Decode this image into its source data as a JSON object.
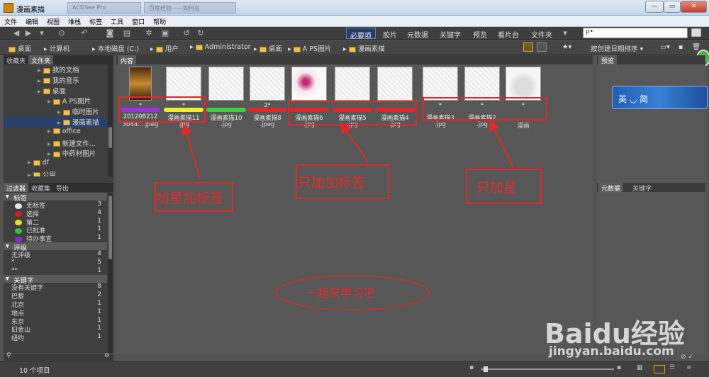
{
  "window": {
    "title": "漫画素描",
    "tab_ghost_1": "ACDSee Pro",
    "tab_ghost_2": "百度经验——如何在"
  },
  "menu": [
    "文件",
    "编辑",
    "视图",
    "堆栈",
    "标签",
    "工具",
    "窗口",
    "帮助"
  ],
  "workspaces": [
    "必要项",
    "胶片",
    "元数据",
    "关键字",
    "预览",
    "看片台",
    "文件夹"
  ],
  "search": {
    "placeholder": "ρ•"
  },
  "breadcrumb": [
    "桌面",
    "计算机",
    "本地磁盘 (C:)",
    "用户",
    "Administrator",
    "桌面",
    "A PS图片",
    "漫画素描"
  ],
  "sort_label": "按创建日期排序",
  "left_tabs": [
    "收藏夹",
    "文件夹"
  ],
  "tree": [
    {
      "label": "我的文档",
      "indent": 62
    },
    {
      "label": "我的音乐",
      "indent": 62
    },
    {
      "label": "桌面",
      "indent": 62
    },
    {
      "label": "A PS图片",
      "indent": 76
    },
    {
      "label": "临时图片",
      "indent": 90
    },
    {
      "label": "漫画素描",
      "indent": 90,
      "selected": true
    },
    {
      "label": "office",
      "indent": 76
    },
    {
      "label": "新建文件...",
      "indent": 76
    },
    {
      "label": "中药材图片",
      "indent": 76
    },
    {
      "label": "df",
      "indent": 48
    },
    {
      "label": "公用",
      "indent": 48
    }
  ],
  "filter_tabs": [
    "过滤器",
    "收藏集",
    "导出"
  ],
  "filters": {
    "labels_heading": "标签",
    "labels": [
      {
        "name": "无标签",
        "count": "3",
        "color": "#e8e8e8"
      },
      {
        "name": "选择",
        "count": "4",
        "color": "#d42020"
      },
      {
        "name": "第二",
        "count": "1",
        "color": "#e8e020"
      },
      {
        "name": "已批准",
        "count": "1",
        "color": "#35c035"
      },
      {
        "name": "待办事宜",
        "count": "1",
        "color": "#8a2ad0"
      }
    ],
    "rating_heading": "评级",
    "ratings": [
      {
        "name": "无评级",
        "count": "4"
      },
      {
        "name": "*",
        "count": "5"
      },
      {
        "name": "**",
        "count": "1"
      }
    ],
    "keyword_heading": "关键字",
    "keywords": [
      {
        "name": "没有关键字",
        "count": "8"
      },
      {
        "name": "巴黎",
        "count": "2"
      },
      {
        "name": "北京",
        "count": "1"
      },
      {
        "name": "地点",
        "count": "1"
      },
      {
        "name": "东京",
        "count": "1"
      },
      {
        "name": "旧金山",
        "count": "1"
      },
      {
        "name": "纽约",
        "count": "1"
      }
    ]
  },
  "content_title": "内容",
  "thumbnails": [
    {
      "stars": "*",
      "label_color": "#9b30e0",
      "name": "201208212",
      "name2": "3044....jpeg"
    },
    {
      "stars": "*",
      "label_color": "#f0ee30",
      "name": "漫画素描11",
      "name2": ".jpg"
    },
    {
      "stars": "",
      "label_color": "#40d040",
      "name": "漫画素描10",
      "name2": ".jpg"
    },
    {
      "stars": "2*",
      "label_color": "#e02828",
      "name": "漫画素描8",
      "name2": ".jpeg"
    },
    {
      "stars": "",
      "label_color": "#e02828",
      "name": "漫画素描6",
      "name2": ".jpg"
    },
    {
      "stars": "",
      "label_color": "#e02828",
      "name": "漫画素描5",
      "name2": ".jpg"
    },
    {
      "stars": "",
      "label_color": "#e02828",
      "name": "漫画素描4",
      "name2": ".jpg"
    },
    {
      "stars": "*",
      "label_color": "",
      "name": "漫画素描3",
      "name2": ".jpg"
    },
    {
      "stars": "*",
      "label_color": "",
      "name": "漫画素描2",
      "name2": ".jpg"
    },
    {
      "stars": "*",
      "label_color": "",
      "name": "",
      "name2": "漫画"
    }
  ],
  "annotations": {
    "star_and_label": "加星加标签",
    "label_only": "只加加标签",
    "star_only": "只加星",
    "learn_together": "一起来学习吧"
  },
  "right": {
    "preview_title": "预览",
    "ime_text": "英 ◡ 简",
    "meta_tab": "元数据",
    "kw_tab": "关键字"
  },
  "status": {
    "count": "10 个项目"
  },
  "watermark": {
    "brand": "Baidu经验",
    "url": "jingyan.baidu.com"
  }
}
